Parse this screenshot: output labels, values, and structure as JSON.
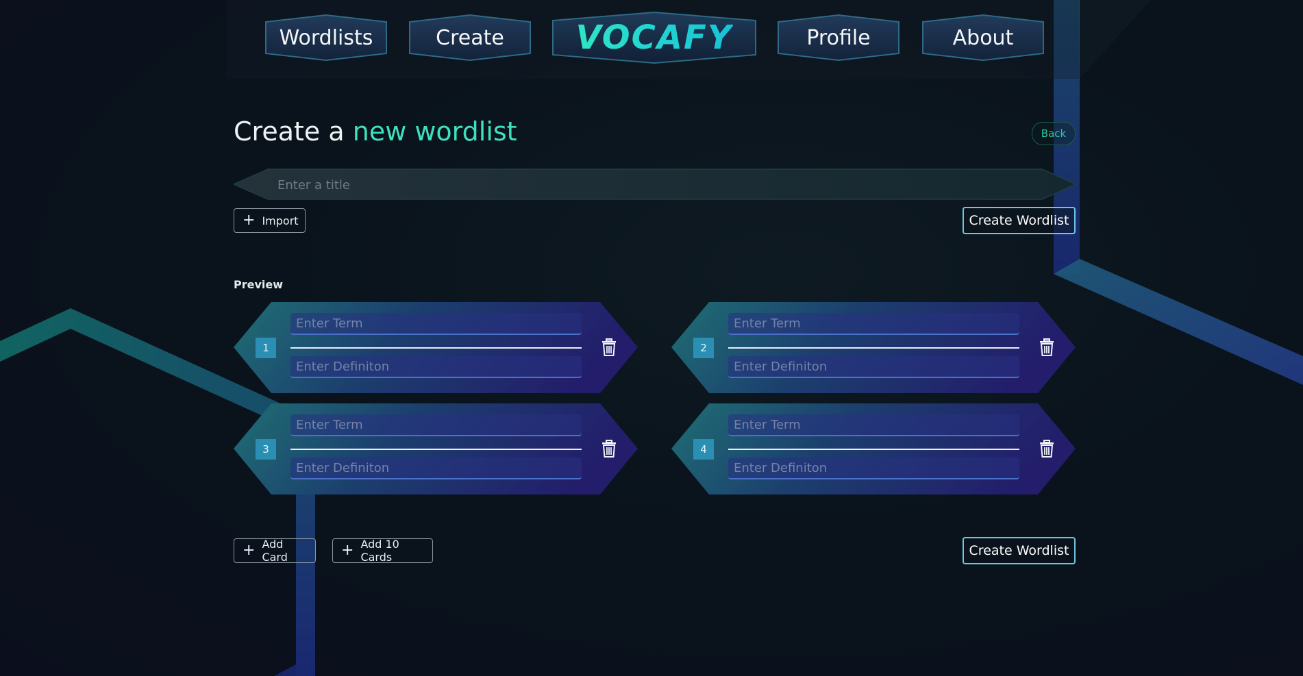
{
  "nav": {
    "items": [
      {
        "label": "Wordlists"
      },
      {
        "label": "Create"
      },
      {
        "label": "VOCAFY"
      },
      {
        "label": "Profile"
      },
      {
        "label": "About"
      }
    ]
  },
  "page": {
    "heading_part1": "Create a",
    "heading_part2": "new wordlist",
    "back_label": "Back"
  },
  "title_input": {
    "placeholder": "Enter a title",
    "value": ""
  },
  "buttons": {
    "import_label": "Import",
    "create_label": "Create Wordlist",
    "add_card_label": "Add Card",
    "add_ten_label": "Add 10 Cards"
  },
  "preview": {
    "label": "Preview",
    "cards": [
      {
        "number": "1",
        "term_placeholder": "Enter Term",
        "definition_placeholder": "Enter Definiton"
      },
      {
        "number": "2",
        "term_placeholder": "Enter Term",
        "definition_placeholder": "Enter Definiton"
      },
      {
        "number": "3",
        "term_placeholder": "Enter Term",
        "definition_placeholder": "Enter Definiton"
      },
      {
        "number": "4",
        "term_placeholder": "Enter Term",
        "definition_placeholder": "Enter Definiton"
      }
    ]
  },
  "colors": {
    "accent": "#3fe0c0",
    "number_badge": "#2a8fb3",
    "primary_border": "#6fc6e3"
  },
  "icons": {
    "plus": "plus-icon",
    "delete": "trash-icon"
  }
}
